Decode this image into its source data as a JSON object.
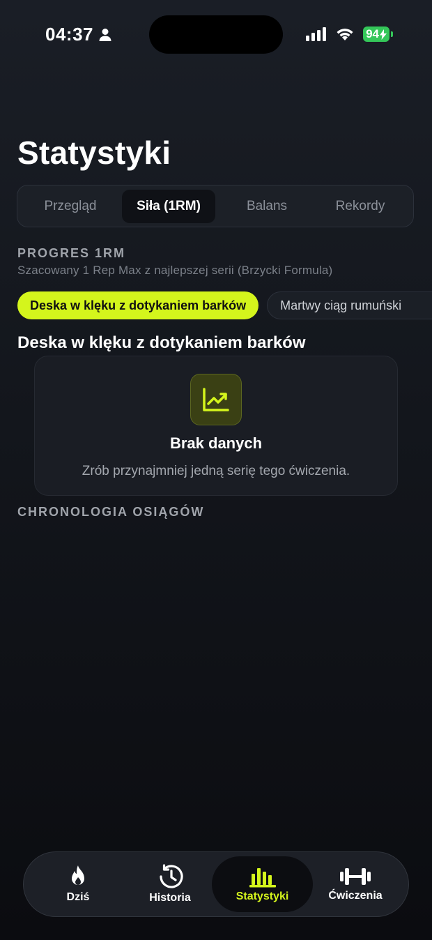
{
  "status_bar": {
    "time": "04:37",
    "battery": "94"
  },
  "page_title": "Statystyki",
  "tabs": [
    {
      "label": "Przegląd",
      "active": false
    },
    {
      "label": "Siła (1RM)",
      "active": true
    },
    {
      "label": "Balans",
      "active": false
    },
    {
      "label": "Rekordy",
      "active": false
    }
  ],
  "progress": {
    "heading": "PROGRES 1RM",
    "subtitle": "Szacowany 1 Rep Max z najlepszej serii (Brzycki Formula)",
    "chips": [
      {
        "label": "Deska w klęku z dotykaniem barków",
        "active": true
      },
      {
        "label": "Martwy ciąg rumuński",
        "active": false
      }
    ],
    "exercise_title": "Deska w klęku z dotykaniem barków",
    "empty": {
      "title": "Brak danych",
      "description": "Zrób przynajmniej jedną serię tego ćwiczenia."
    }
  },
  "timeline": {
    "heading": "CHRONOLOGIA OSIĄGÓW"
  },
  "bottom_nav": {
    "items": [
      {
        "label": "Dziś",
        "icon": "flame-icon"
      },
      {
        "label": "Historia",
        "icon": "history-icon"
      },
      {
        "label": "Statystyki",
        "icon": "bar-chart-icon",
        "active": true
      },
      {
        "label": "Ćwiczenia",
        "icon": "dumbbell-icon"
      }
    ]
  },
  "colors": {
    "accent": "#d4f51c",
    "background": "#13161c",
    "battery": "#34c759"
  }
}
